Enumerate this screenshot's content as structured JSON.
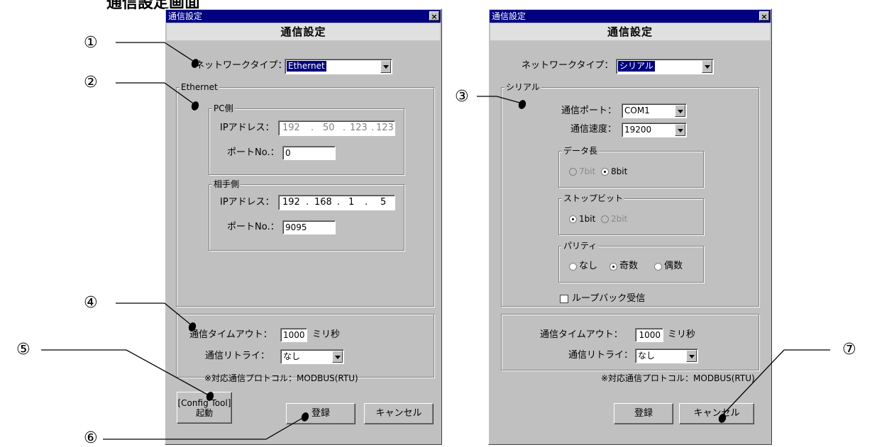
{
  "page_heading": "通信設定画面",
  "callouts": {
    "c1": "①",
    "c2": "②",
    "c3": "③",
    "c4": "④",
    "c5": "⑤",
    "c6": "⑥",
    "c7": "⑦"
  },
  "left_dialog": {
    "window_title": "通信設定",
    "close_label": "×",
    "header": "通信設定",
    "network_type_label": "ネットワークタイプ：",
    "network_type_value": "Ethernet",
    "ethernet_group": "Ethernet",
    "pc_group": "PC側",
    "pc_ip_label": "IPアドレス：",
    "pc_ip": [
      "192",
      "50",
      "123",
      "123"
    ],
    "pc_port_label": "ポートNo.：",
    "pc_port": "0",
    "remote_group": "相手側",
    "remote_ip_label": "IPアドレス：",
    "remote_ip": [
      "192",
      "168",
      "1",
      "5"
    ],
    "remote_port_label": "ポートNo.：",
    "remote_port": "9095",
    "timeout_label": "通信タイムアウト：",
    "timeout_value": "1000",
    "timeout_unit": "ミリ秒",
    "retry_label": "通信リトライ：",
    "retry_value": "なし",
    "protocol_note": "※対応通信プロトコル：MODBUS(RTU)",
    "config_tool_button": "[Config Tool]\n起動",
    "register_button": "登録",
    "cancel_button": "キャンセル"
  },
  "right_dialog": {
    "window_title": "通信設定",
    "close_label": "×",
    "header": "通信設定",
    "network_type_label": "ネットワークタイプ：",
    "network_type_value": "シリアル",
    "serial_group": "シリアル",
    "port_label": "通信ポート：",
    "port_value": "COM1",
    "speed_label": "通信速度：",
    "speed_value": "19200",
    "data_length_group": "データ長",
    "data_7bit": "7bit",
    "data_8bit": "8bit",
    "stop_bit_group": "ストップビット",
    "stop_1bit": "1bit",
    "stop_2bit": "2bit",
    "parity_group": "パリティ",
    "parity_none": "なし",
    "parity_odd": "奇数",
    "parity_even": "偶数",
    "loopback_label": "ループバック受信",
    "timeout_label": "通信タイムアウト：",
    "timeout_value": "1000",
    "timeout_unit": "ミリ秒",
    "retry_label": "通信リトライ：",
    "retry_value": "なし",
    "protocol_note": "※対応通信プロトコル：MODBUS(RTU)",
    "register_button": "登録",
    "cancel_button": "キャンセル"
  }
}
